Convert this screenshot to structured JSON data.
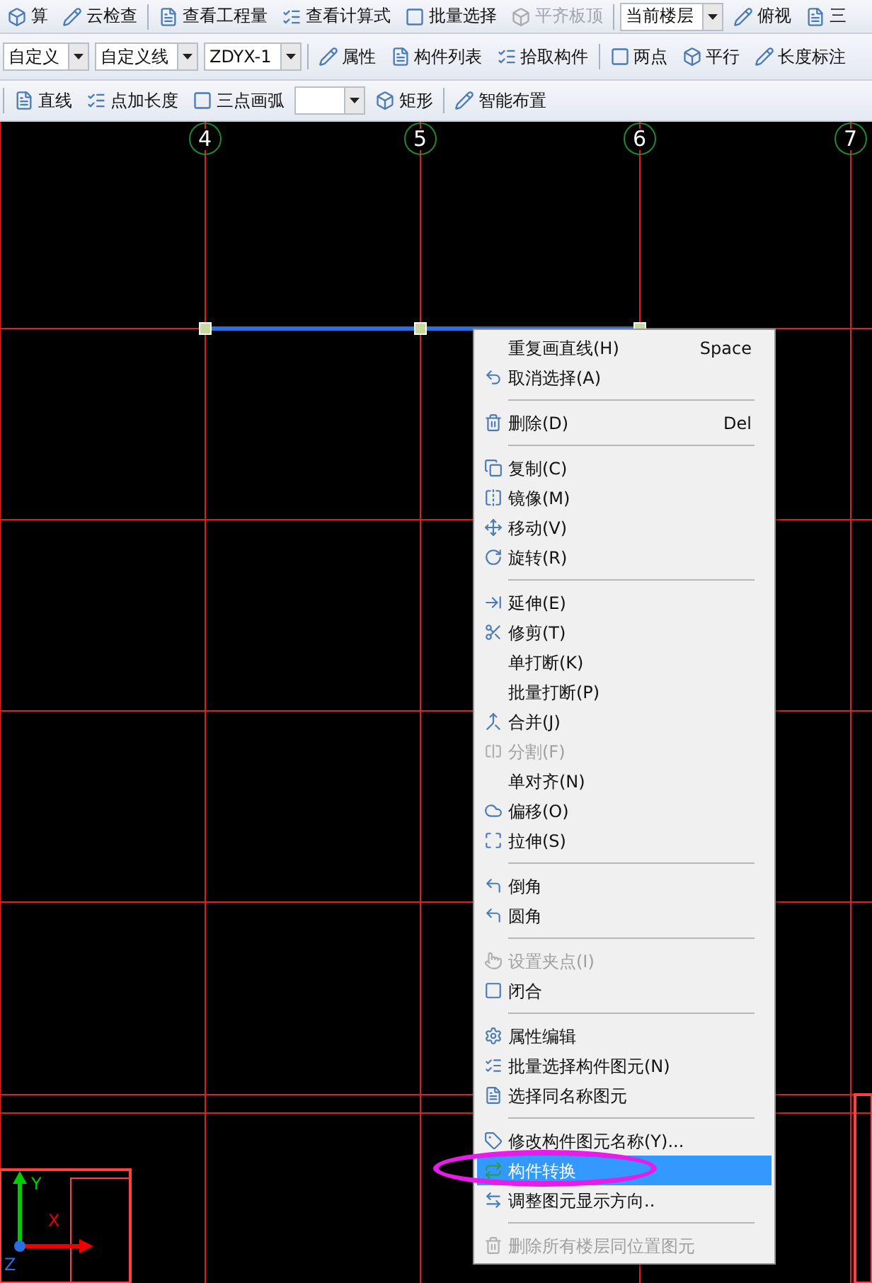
{
  "toolbars": [
    {
      "items": [
        {
          "kind": "button",
          "label": "算",
          "disabled": false
        },
        {
          "kind": "button",
          "label": "云检查",
          "disabled": false
        },
        {
          "kind": "separator"
        },
        {
          "kind": "button",
          "label": "查看工程量",
          "disabled": false
        },
        {
          "kind": "button",
          "label": "查看计算式",
          "disabled": false
        },
        {
          "kind": "button",
          "label": "批量选择",
          "disabled": false
        },
        {
          "kind": "button",
          "label": "平齐板顶",
          "disabled": true
        },
        {
          "kind": "separator"
        },
        {
          "kind": "dropdown",
          "value": "当前楼层"
        },
        {
          "kind": "button",
          "label": "俯视",
          "disabled": false
        },
        {
          "kind": "button",
          "label": "三",
          "disabled": false
        }
      ]
    },
    {
      "items": [
        {
          "kind": "dropdown",
          "value": "自定义"
        },
        {
          "kind": "dropdown",
          "value": "自定义线"
        },
        {
          "kind": "dropdown",
          "value": "ZDYX-1"
        },
        {
          "kind": "separator"
        },
        {
          "kind": "button",
          "label": "属性",
          "disabled": false
        },
        {
          "kind": "button",
          "label": "构件列表",
          "disabled": false
        },
        {
          "kind": "button",
          "label": "拾取构件",
          "disabled": false
        },
        {
          "kind": "separator"
        },
        {
          "kind": "button",
          "label": "两点",
          "disabled": false
        },
        {
          "kind": "button",
          "label": "平行",
          "disabled": false
        },
        {
          "kind": "button",
          "label": "长度标注",
          "disabled": false
        }
      ]
    },
    {
      "items": [
        {
          "kind": "separator"
        },
        {
          "kind": "button",
          "label": "直线",
          "disabled": false
        },
        {
          "kind": "button",
          "label": "点加长度",
          "disabled": false
        },
        {
          "kind": "button",
          "label": "三点画弧",
          "disabled": false
        },
        {
          "kind": "dropdown",
          "value": ""
        },
        {
          "kind": "button",
          "label": "矩形",
          "disabled": false
        },
        {
          "kind": "separator"
        },
        {
          "kind": "button",
          "label": "智能布置",
          "disabled": false
        }
      ]
    }
  ],
  "axes": [
    "4",
    "5",
    "6",
    "7"
  ],
  "ucs": {
    "y": "Y",
    "x": "X",
    "z": "Z"
  },
  "menu": [
    {
      "kind": "item",
      "label": "重复画直线(H)",
      "shortcut": "Space",
      "icon": false,
      "disabled": false,
      "selected": false
    },
    {
      "kind": "item",
      "label": "取消选择(A)",
      "icon": true,
      "disabled": false,
      "selected": false
    },
    {
      "kind": "separator"
    },
    {
      "kind": "item",
      "label": "删除(D)",
      "shortcut": "Del",
      "icon": true,
      "disabled": false,
      "selected": false
    },
    {
      "kind": "separator"
    },
    {
      "kind": "item",
      "label": "复制(C)",
      "icon": true,
      "disabled": false,
      "selected": false
    },
    {
      "kind": "item",
      "label": "镜像(M)",
      "icon": true,
      "disabled": false,
      "selected": false
    },
    {
      "kind": "item",
      "label": "移动(V)",
      "icon": true,
      "disabled": false,
      "selected": false
    },
    {
      "kind": "item",
      "label": "旋转(R)",
      "icon": true,
      "disabled": false,
      "selected": false
    },
    {
      "kind": "separator"
    },
    {
      "kind": "item",
      "label": "延伸(E)",
      "icon": true,
      "disabled": false,
      "selected": false
    },
    {
      "kind": "item",
      "label": "修剪(T)",
      "icon": true,
      "disabled": false,
      "selected": false
    },
    {
      "kind": "item",
      "label": "单打断(K)",
      "icon": false,
      "disabled": false,
      "selected": false
    },
    {
      "kind": "item",
      "label": "批量打断(P)",
      "icon": false,
      "disabled": false,
      "selected": false
    },
    {
      "kind": "item",
      "label": "合并(J)",
      "icon": true,
      "disabled": false,
      "selected": false
    },
    {
      "kind": "item",
      "label": "分割(F)",
      "icon": true,
      "disabled": true,
      "selected": false
    },
    {
      "kind": "item",
      "label": "单对齐(N)",
      "icon": false,
      "disabled": false,
      "selected": false
    },
    {
      "kind": "item",
      "label": "偏移(O)",
      "icon": true,
      "disabled": false,
      "selected": false
    },
    {
      "kind": "item",
      "label": "拉伸(S)",
      "icon": true,
      "disabled": false,
      "selected": false
    },
    {
      "kind": "separator"
    },
    {
      "kind": "item",
      "label": "倒角",
      "icon": true,
      "disabled": false,
      "selected": false
    },
    {
      "kind": "item",
      "label": "圆角",
      "icon": true,
      "disabled": false,
      "selected": false
    },
    {
      "kind": "separator"
    },
    {
      "kind": "item",
      "label": "设置夹点(I)",
      "icon": true,
      "disabled": true,
      "selected": false
    },
    {
      "kind": "item",
      "label": "闭合",
      "icon": true,
      "disabled": false,
      "selected": false
    },
    {
      "kind": "separator"
    },
    {
      "kind": "item",
      "label": "属性编辑",
      "icon": true,
      "disabled": false,
      "selected": false
    },
    {
      "kind": "item",
      "label": "批量选择构件图元(N)",
      "icon": true,
      "disabled": false,
      "selected": false
    },
    {
      "kind": "item",
      "label": "选择同名称图元",
      "icon": true,
      "disabled": false,
      "selected": false
    },
    {
      "kind": "separator"
    },
    {
      "kind": "item",
      "label": "修改构件图元名称(Y)...",
      "icon": true,
      "disabled": false,
      "selected": false
    },
    {
      "kind": "item",
      "label": "构件转换",
      "icon": true,
      "disabled": false,
      "selected": true
    },
    {
      "kind": "item",
      "label": "调整图元显示方向..",
      "icon": true,
      "disabled": false,
      "selected": false
    },
    {
      "kind": "separator"
    },
    {
      "kind": "item",
      "label": "删除所有楼层同位置图元",
      "icon": true,
      "disabled": true,
      "selected": false
    }
  ]
}
